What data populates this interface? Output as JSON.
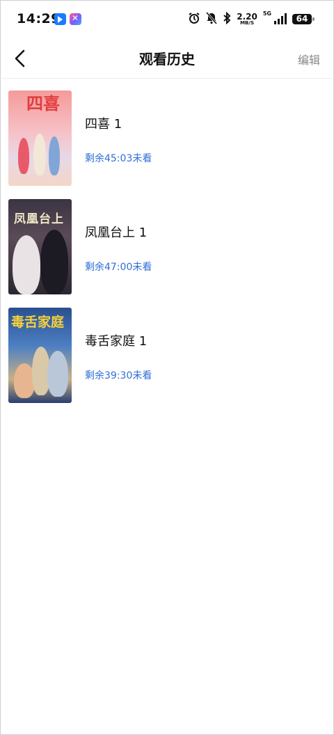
{
  "status_bar": {
    "time": "14:29",
    "net_speed_value": "2.20",
    "net_speed_unit": "MB/S",
    "network_type": "5G",
    "battery": "64"
  },
  "header": {
    "title": "观看历史",
    "edit_label": "编辑",
    "back_icon": "chevron-left-icon"
  },
  "history": [
    {
      "name": "四喜 1",
      "remaining": "剩余45:03未看",
      "poster_text": "四喜"
    },
    {
      "name": "凤凰台上 1",
      "remaining": "剩余47:00未看",
      "poster_text": "凤凰台上"
    },
    {
      "name": "毒舌家庭 1",
      "remaining": "剩余39:30未看",
      "poster_text": "毒舌家庭"
    }
  ],
  "colors": {
    "accent_text": "#2f6fd6",
    "edit_text": "#888888"
  }
}
